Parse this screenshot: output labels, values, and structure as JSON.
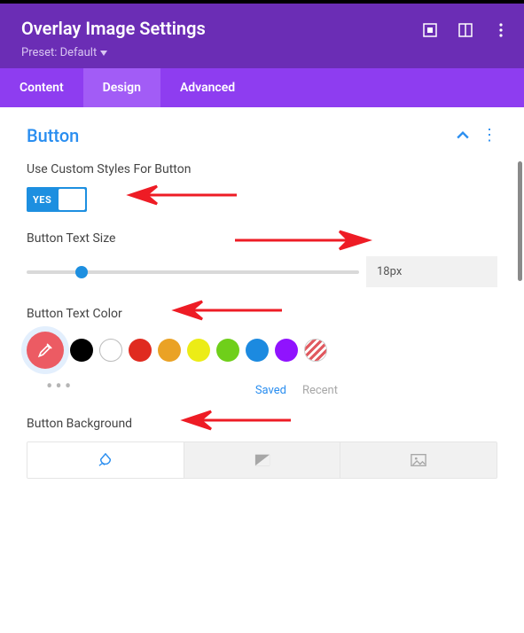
{
  "header": {
    "title": "Overlay Image Settings",
    "preset_label": "Preset: Default"
  },
  "tabs": {
    "content": "Content",
    "design": "Design",
    "advanced": "Advanced"
  },
  "section": {
    "title": "Button"
  },
  "fields": {
    "custom_styles": {
      "label": "Use Custom Styles For Button",
      "value_label": "YES"
    },
    "text_size": {
      "label": "Button Text Size",
      "value": "18px"
    },
    "text_color": {
      "label": "Button Text Color"
    },
    "background": {
      "label": "Button Background"
    }
  },
  "palette": {
    "saved": "Saved",
    "recent": "Recent",
    "colors": [
      "#000000",
      "#ffffff",
      "#e02b20",
      "#eaa225",
      "#ecec16",
      "#6fcf1a",
      "#1c8ae0",
      "#9013fe"
    ]
  }
}
